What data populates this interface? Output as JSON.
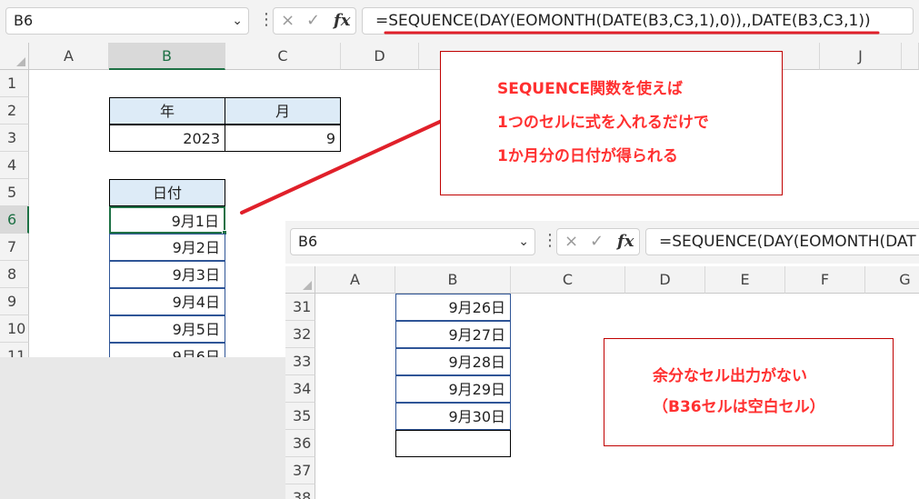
{
  "back": {
    "name_box": "B6",
    "formula": "=SEQUENCE(DAY(EOMONTH(DATE(B3,C3,1),0)),,DATE(B3,C3,1))",
    "fx_cancel": "×",
    "fx_enter": "✓",
    "fx_label": "fx",
    "columns": [
      "A",
      "B",
      "C",
      "D",
      "J"
    ],
    "rows": [
      "1",
      "2",
      "3",
      "4",
      "5",
      "6",
      "7",
      "8",
      "9",
      "10",
      "11"
    ],
    "table_headers": {
      "year": "年",
      "month": "月"
    },
    "table_values": {
      "year": "2023",
      "month": "9"
    },
    "date_header": "日付",
    "dates": [
      "9月1日",
      "9月2日",
      "9月3日",
      "9月4日",
      "9月5日",
      "9月6日"
    ]
  },
  "front": {
    "name_box": "B6",
    "formula": "=SEQUENCE(DAY(EOMONTH(DAT",
    "fx_cancel": "×",
    "fx_enter": "✓",
    "fx_label": "fx",
    "columns": [
      "A",
      "B",
      "C",
      "D",
      "E",
      "F",
      "G"
    ],
    "rows": [
      "31",
      "32",
      "33",
      "34",
      "35",
      "36",
      "37",
      "38"
    ],
    "dates": [
      "9月26日",
      "9月27日",
      "9月28日",
      "9月29日",
      "9月30日"
    ]
  },
  "callouts": {
    "top": [
      "SEQUENCE関数を使えば",
      "1つのセルに式を入れるだけで",
      "1か月分の日付が得られる"
    ],
    "bottom": [
      "余分なセル出力がない",
      "（B36セルは空白セル）"
    ]
  },
  "colors": {
    "accent_red": "#e0202a",
    "excel_green": "#1e7145",
    "header_blue": "#ddebf7",
    "callout_text": "#ff3030"
  },
  "icons": {
    "dropdown": "chevron-down-icon",
    "more": "vertical-dots-icon",
    "cancel": "close-icon",
    "enter": "check-icon"
  }
}
